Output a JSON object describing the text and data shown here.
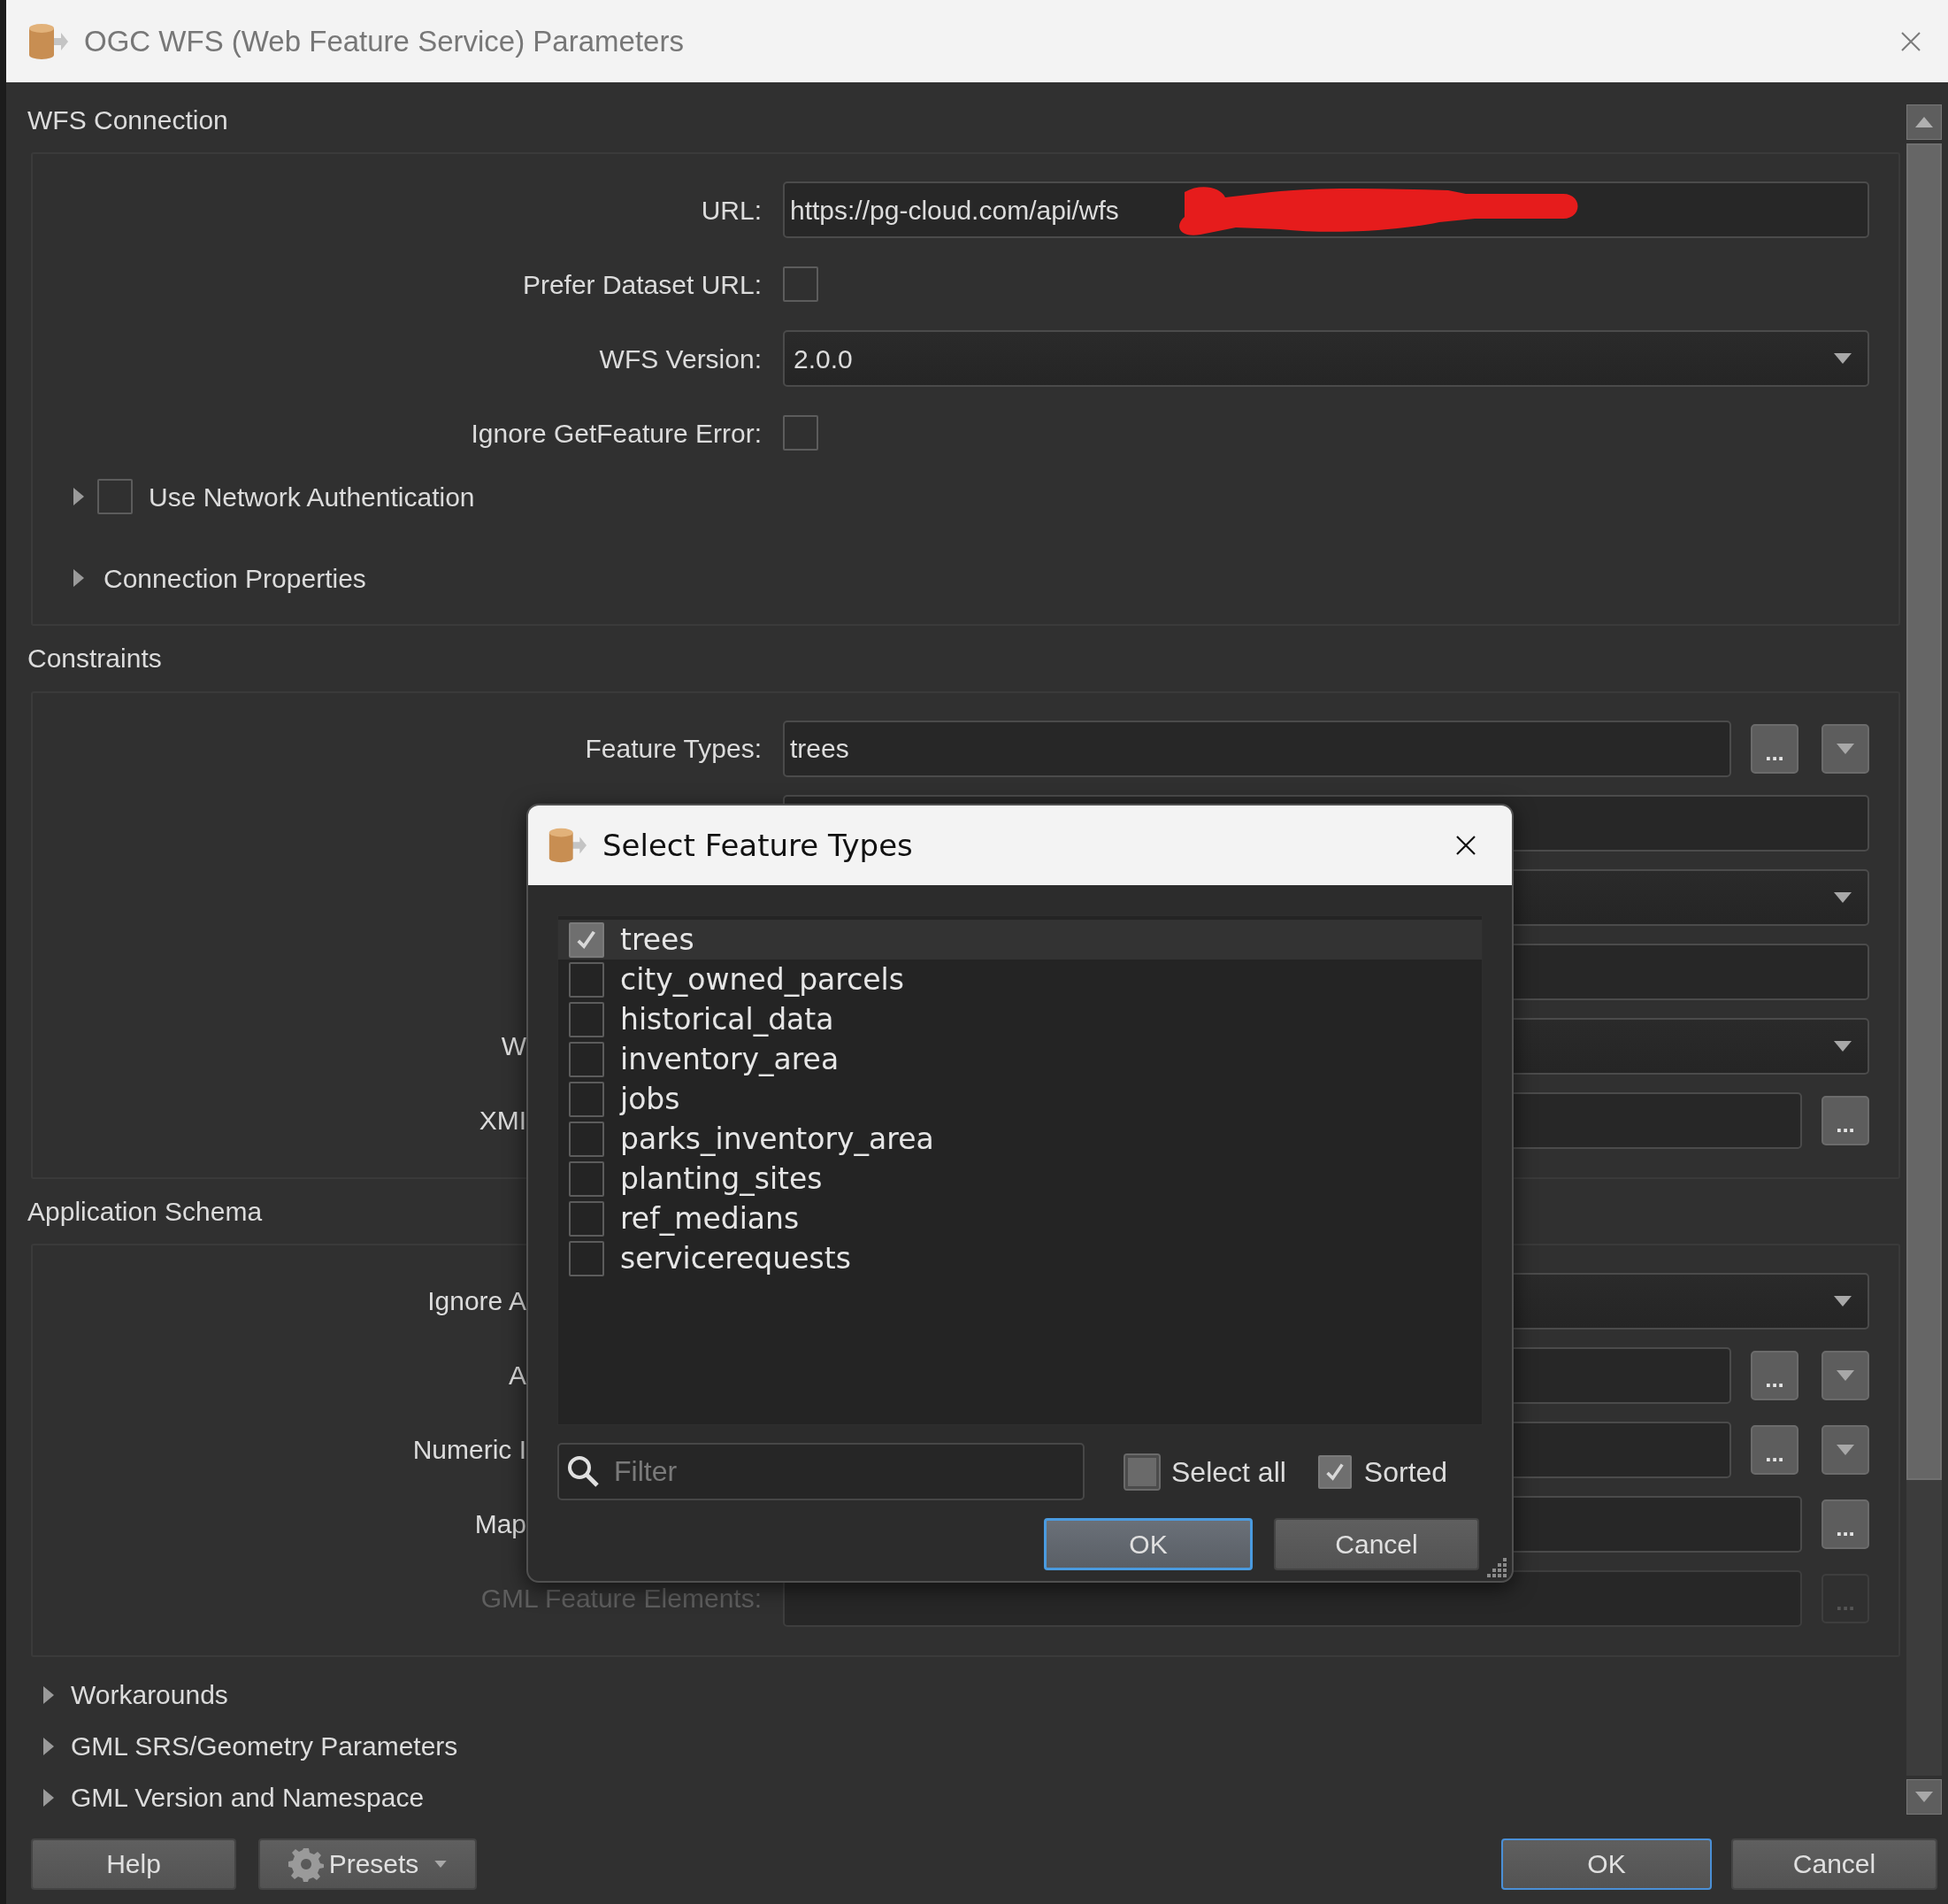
{
  "window": {
    "title": "OGC WFS (Web Feature Service) Parameters"
  },
  "groups": [
    {
      "title": "WFS Connection",
      "rows": [
        {
          "kind": "text",
          "label": "URL:",
          "value": "https://pg-cloud.com/api/wfs",
          "redacted": true
        },
        {
          "kind": "checkbox",
          "label": "Prefer Dataset URL:",
          "checked": false
        },
        {
          "kind": "dropdown",
          "label": "WFS Version:",
          "value": "2.0.0"
        },
        {
          "kind": "checkbox",
          "label": "Ignore GetFeature Error:",
          "checked": false
        }
      ],
      "subsections": [
        {
          "kind": "checkbox",
          "label": "Use Network Authentication",
          "expanded": false,
          "checked": false
        },
        {
          "kind": "plain",
          "label": "Connection Properties",
          "expanded": false
        }
      ]
    },
    {
      "title": "Constraints",
      "rows": [
        {
          "kind": "text",
          "label": "Feature Types:",
          "value": "trees",
          "browse": "...",
          "menu_button": true
        },
        {
          "kind": "text"
        },
        {
          "kind": "dropdown"
        },
        {
          "kind": "text"
        },
        {
          "kind": "dropdown",
          "label": "W",
          "covered": true
        },
        {
          "kind": "text",
          "label": "XMI",
          "covered": true,
          "browse": "..."
        }
      ]
    },
    {
      "title": "Application Schema",
      "rows": [
        {
          "kind": "dropdown",
          "label": "Ignore A",
          "covered": true
        },
        {
          "kind": "text",
          "label": "A",
          "covered": true,
          "browse": "...",
          "menu_button": true
        },
        {
          "kind": "text",
          "label": "Numeric I",
          "covered": true,
          "browse": "...",
          "menu_button": true
        },
        {
          "kind": "text",
          "label": "Map",
          "covered": true,
          "browse": "..."
        },
        {
          "kind": "text",
          "label": "GML Feature Elements:",
          "disabled": true,
          "browse": "..."
        }
      ]
    }
  ],
  "collapsed_sections": [
    {
      "label": "Workarounds",
      "expanded": false
    },
    {
      "label": "GML SRS/Geometry Parameters",
      "expanded": false
    },
    {
      "label": "GML Version and Namespace",
      "expanded": false
    }
  ],
  "footer": {
    "left_buttons": [
      {
        "kind": "plain",
        "label": "Help"
      },
      {
        "kind": "menu",
        "label": "Presets"
      }
    ],
    "right_buttons": [
      {
        "label": "OK",
        "default": true
      },
      {
        "label": "Cancel",
        "default": false
      }
    ]
  },
  "dialog": {
    "title": "Select Feature Types",
    "items": [
      {
        "label": "trees",
        "checked": true,
        "selected": true
      },
      {
        "label": "city_owned_parcels",
        "checked": false,
        "selected": false
      },
      {
        "label": "historical_data",
        "checked": false,
        "selected": false
      },
      {
        "label": "inventory_area",
        "checked": false,
        "selected": false
      },
      {
        "label": "jobs",
        "checked": false,
        "selected": false
      },
      {
        "label": "parks_inventory_area",
        "checked": false,
        "selected": false
      },
      {
        "label": "planting_sites",
        "checked": false,
        "selected": false
      },
      {
        "label": "ref_medians",
        "checked": false,
        "selected": false
      },
      {
        "label": "servicerequests",
        "checked": false,
        "selected": false
      }
    ],
    "filter": {
      "placeholder": "Filter"
    },
    "options": [
      {
        "label": "Select all",
        "checked": false,
        "partial": true
      },
      {
        "label": "Sorted",
        "checked": true
      }
    ],
    "buttons": [
      {
        "label": "OK",
        "default": true
      },
      {
        "label": "Cancel",
        "default": false
      }
    ]
  }
}
